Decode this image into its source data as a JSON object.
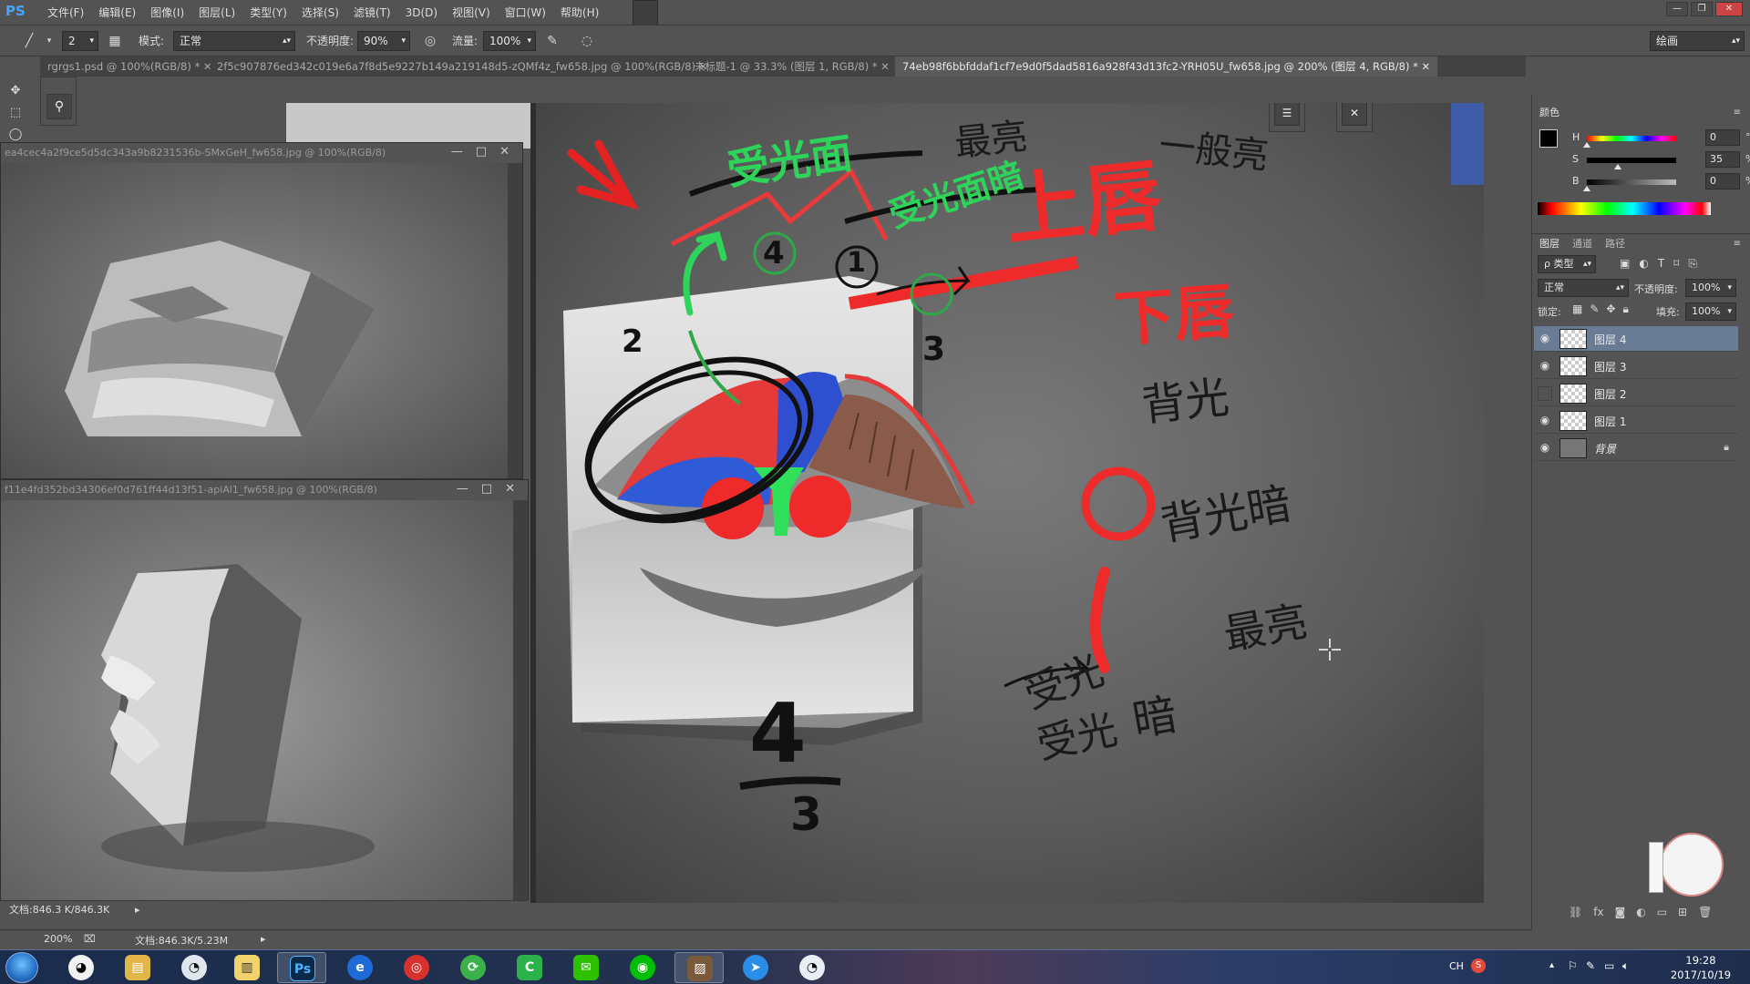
{
  "app": {
    "logo": "PS"
  },
  "menu": [
    "文件(F)",
    "编辑(E)",
    "图像(I)",
    "图层(L)",
    "类型(Y)",
    "选择(S)",
    "滤镜(T)",
    "3D(D)",
    "视图(V)",
    "窗口(W)",
    "帮助(H)"
  ],
  "options": {
    "brush_size": "2",
    "mode_label": "模式:",
    "mode_value": "正常",
    "opacity_label": "不透明度:",
    "opacity_value": "90%",
    "flow_label": "流量:",
    "flow_value": "100%",
    "workspace": "绘画"
  },
  "tabs": [
    "rgrgs1.psd @ 100%(RGB/8) *",
    "2f5c907876ed342c019e6a7f8d5e9227b149a219148d5-zQMf4z_fw658.jpg @ 100%(RGB/8)",
    "未标题-1 @ 33.3% (图层 1, RGB/8) *",
    "74eb98f6bbfddaf1cf7e9d0f5dad5816a928f43d13fc2-YRH05U_fw658.jpg @ 200% (图层 4, RGB/8) *"
  ],
  "doc_windows": {
    "top_title": "ea4cec4a2f9ce5d5dc343a9b8231536b-SMxGeH_fw658.jpg @ 100%(RGB/8)",
    "bottom_title": "f11e4fd352bd34306ef0d761ff44d13f51-apiAl1_fw658.jpg @ 100%(RGB/8)",
    "bottom_status": "文档:846.3 K/846.3K"
  },
  "annotations": {
    "liangmian": "受光面",
    "zuiliang_top": "最亮",
    "shouguangmian_an": "受光面暗",
    "yibanliang": "一般亮",
    "shang_chun": "上唇",
    "xia_chun": "下唇",
    "beiguang": "背光",
    "beiguang_an": "背光暗",
    "zuiliang_bottom": "最亮",
    "shouguang_a": "受光",
    "shouguang_b": "受光",
    "an": "暗",
    "num_1": "1",
    "num_2": "2",
    "num_3": "3",
    "num_4": "4",
    "fraction_top": "4",
    "fraction_bottom": "3"
  },
  "status_bar": {
    "zoom": "200%",
    "doc": "文档:846.3K/5.23M"
  },
  "color_panel": {
    "title": "颜色",
    "h_label": "H",
    "h_value": "0",
    "h_unit": "°",
    "s_label": "S",
    "s_value": "35",
    "s_unit": "%",
    "b_label": "B",
    "b_value": "0",
    "b_unit": "%",
    "foreground": "#000000",
    "background": "#2a55c8"
  },
  "layers_panel": {
    "tabs": [
      "图层",
      "通道",
      "路径"
    ],
    "filter_label": "ρ 类型",
    "blend_mode": "正常",
    "opacity_label": "不透明度:",
    "opacity_value": "100%",
    "lock_label": "锁定:",
    "fill_label": "填充:",
    "fill_value": "100%",
    "layers": [
      {
        "name": "图层 4",
        "visible": true,
        "selected": true
      },
      {
        "name": "图层 3",
        "visible": true,
        "selected": false
      },
      {
        "name": "图层 2",
        "visible": false,
        "selected": false
      },
      {
        "name": "图层 1",
        "visible": true,
        "selected": false
      },
      {
        "name": "背景",
        "visible": true,
        "selected": false,
        "locked": true
      }
    ]
  },
  "taskbar": {
    "apps": [
      "qq-icon",
      "explorer-icon",
      "qq-penguin-icon",
      "notepad-icon",
      "photoshop-icon",
      "browser-icon",
      "netease-music-icon",
      "360-icon",
      "camtasia-icon",
      "wechat-icon",
      "iqiyi-icon",
      "image-icon",
      "feishu-icon",
      "tim-icon"
    ],
    "ps_label": "Ps",
    "ime": "CH",
    "time": "19:28",
    "date": "2017/10/19"
  }
}
